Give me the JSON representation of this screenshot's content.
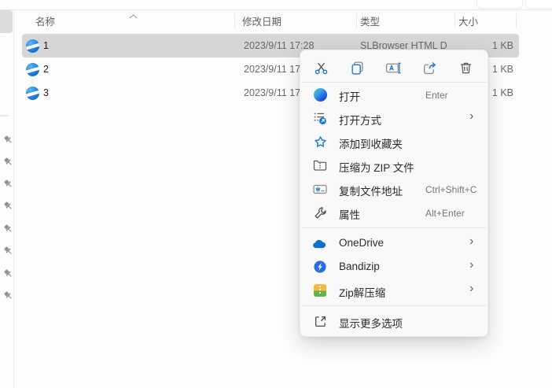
{
  "file_list": {
    "columns": [
      {
        "label": "名称"
      },
      {
        "label": "修改日期"
      },
      {
        "label": "类型"
      },
      {
        "label": "大小"
      }
    ],
    "rows": [
      {
        "name": "1",
        "date": "2023/9/11 17:28",
        "type": "SLBrowser HTML D",
        "size": "1 KB",
        "selected": true
      },
      {
        "name": "2",
        "date": "2023/9/11 17",
        "type": "",
        "size": "1 KB",
        "selected": false
      },
      {
        "name": "3",
        "date": "2023/9/11 17",
        "type": "",
        "size": "1 KB",
        "selected": false
      }
    ]
  },
  "context_menu": {
    "quick_actions": [
      {
        "name": "cut"
      },
      {
        "name": "copy"
      },
      {
        "name": "rename"
      },
      {
        "name": "share"
      },
      {
        "name": "delete"
      }
    ],
    "items": [
      {
        "label": "打开",
        "shortcut": "Enter",
        "icon": "edge-browser",
        "submenu": false
      },
      {
        "label": "打开方式",
        "shortcut": "",
        "icon": "open-with",
        "submenu": true
      },
      {
        "label": "添加到收藏夹",
        "shortcut": "",
        "icon": "star",
        "submenu": false
      },
      {
        "label": "压缩为 ZIP 文件",
        "shortcut": "",
        "icon": "zip-folder",
        "submenu": false
      },
      {
        "label": "复制文件地址",
        "shortcut": "Ctrl+Shift+C",
        "icon": "copy-path",
        "submenu": false
      },
      {
        "label": "属性",
        "shortcut": "Alt+Enter",
        "icon": "wrench",
        "submenu": false
      },
      {
        "label": "OneDrive",
        "shortcut": "",
        "icon": "onedrive-cloud",
        "submenu": true
      },
      {
        "label": "Bandizip",
        "shortcut": "",
        "icon": "bandizip",
        "submenu": true
      },
      {
        "label": "Zip解压缩",
        "shortcut": "",
        "icon": "zip-utility",
        "submenu": true
      },
      {
        "label": "显示更多选项",
        "shortcut": "",
        "icon": "show-more",
        "submenu": false
      }
    ],
    "submenu_chevron": "›"
  },
  "colors": {
    "accent_blue": "#1576d6",
    "selection_gray": "#d6d6d6",
    "menu_background": "#f9f9f9"
  }
}
